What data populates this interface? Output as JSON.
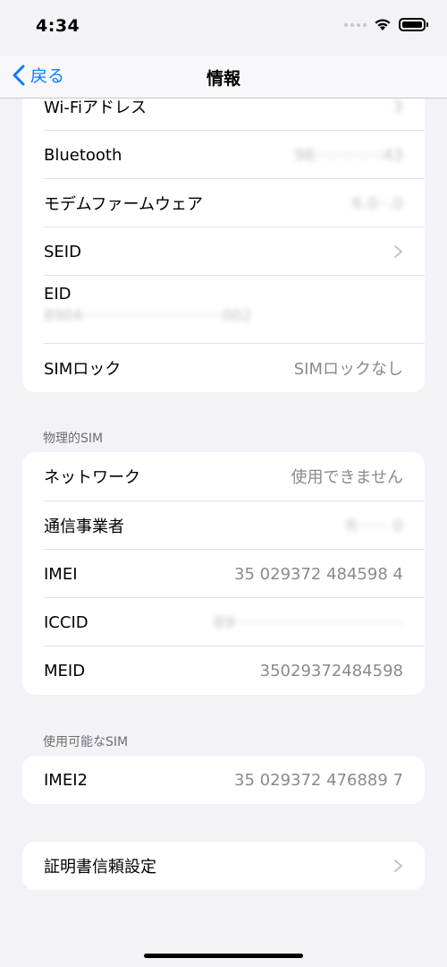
{
  "status": {
    "time": "4:34"
  },
  "nav": {
    "back_label": "戻る",
    "title": "情報"
  },
  "section1": {
    "rows": [
      {
        "label": "Wi-Fiアドレス",
        "value": "3"
      },
      {
        "label": "Bluetooth",
        "value": "98:··:··:··:··:43"
      },
      {
        "label": "モデムファームウェア",
        "value": "6.0··.0"
      },
      {
        "label": "SEID",
        "value": ""
      },
      {
        "label": "EID",
        "value": "8904·····························002"
      },
      {
        "label": "SIMロック",
        "value": "SIMロックなし"
      }
    ]
  },
  "section2": {
    "header": "物理的SIM",
    "rows": [
      {
        "label": "ネットワーク",
        "value": "使用できません"
      },
      {
        "label": "通信事業者",
        "value": "R······ 0"
      },
      {
        "label": "IMEI",
        "value": "35 029372 484598 4"
      },
      {
        "label": "ICCID",
        "value": "89·································"
      },
      {
        "label": "MEID",
        "value": "35029372484598"
      }
    ]
  },
  "section3": {
    "header": "使用可能なSIM",
    "rows": [
      {
        "label": "IMEI2",
        "value": "35 029372 476889 7"
      }
    ]
  },
  "section4": {
    "rows": [
      {
        "label": "証明書信頼設定",
        "value": ""
      }
    ]
  },
  "icons": {
    "back": "chevron-left-icon",
    "disclosure": "chevron-right-icon",
    "wifi": "wifi-icon",
    "battery": "battery-icon",
    "signal": "signal-dots-icon"
  },
  "colors": {
    "accent": "#0a7aff",
    "background": "#f2f2f7",
    "secondary_text": "#8a8a8e"
  }
}
